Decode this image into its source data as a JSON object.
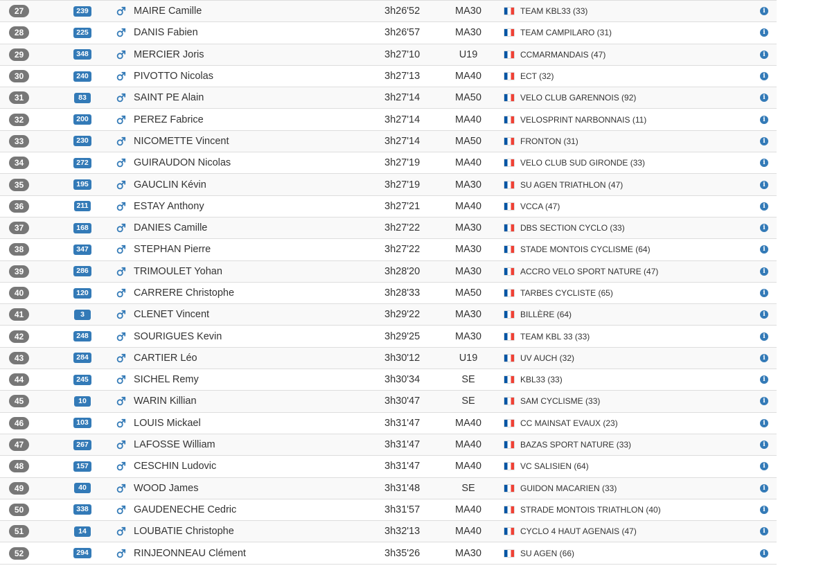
{
  "colors": {
    "rank_badge": "#777777",
    "bib_badge": "#337ab7",
    "male_icon": "#337ab7",
    "info_icon": "#337ab7",
    "row_alt": "#f9f9f9",
    "border": "#dddddd"
  },
  "icons": {
    "sex": "male-icon",
    "flag": "france-flag-icon",
    "info": "info-circle-icon"
  },
  "rows": [
    {
      "rank": "27",
      "bib": "239",
      "name": "MAIRE Camille",
      "time": "3h26'52",
      "category": "MA30",
      "club": "TEAM KBL33 (33)"
    },
    {
      "rank": "28",
      "bib": "225",
      "name": "DANIS Fabien",
      "time": "3h26'57",
      "category": "MA30",
      "club": "TEAM CAMPILARO (31)"
    },
    {
      "rank": "29",
      "bib": "348",
      "name": "MERCIER Joris",
      "time": "3h27'10",
      "category": "U19",
      "club": "CCMARMANDAIS (47)"
    },
    {
      "rank": "30",
      "bib": "240",
      "name": "PIVOTTO Nicolas",
      "time": "3h27'13",
      "category": "MA40",
      "club": "ECT (32)"
    },
    {
      "rank": "31",
      "bib": "83",
      "name": "SAINT PE Alain",
      "time": "3h27'14",
      "category": "MA50",
      "club": "VELO CLUB GARENNOIS (92)"
    },
    {
      "rank": "32",
      "bib": "200",
      "name": "PEREZ Fabrice",
      "time": "3h27'14",
      "category": "MA40",
      "club": "VELOSPRINT NARBONNAIS (11)"
    },
    {
      "rank": "33",
      "bib": "230",
      "name": "NICOMETTE Vincent",
      "time": "3h27'14",
      "category": "MA50",
      "club": "FRONTON (31)"
    },
    {
      "rank": "34",
      "bib": "272",
      "name": "GUIRAUDON Nicolas",
      "time": "3h27'19",
      "category": "MA40",
      "club": "VELO CLUB SUD GIRONDE (33)"
    },
    {
      "rank": "35",
      "bib": "195",
      "name": "GAUCLIN Kévin",
      "time": "3h27'19",
      "category": "MA30",
      "club": "SU AGEN TRIATHLON (47)"
    },
    {
      "rank": "36",
      "bib": "211",
      "name": "ESTAY Anthony",
      "time": "3h27'21",
      "category": "MA40",
      "club": "VCCA (47)"
    },
    {
      "rank": "37",
      "bib": "168",
      "name": "DANIES Camille",
      "time": "3h27'22",
      "category": "MA30",
      "club": "DBS SECTION CYCLO (33)"
    },
    {
      "rank": "38",
      "bib": "347",
      "name": "STEPHAN Pierre",
      "time": "3h27'22",
      "category": "MA30",
      "club": "STADE MONTOIS CYCLISME (64)"
    },
    {
      "rank": "39",
      "bib": "286",
      "name": "TRIMOULET Yohan",
      "time": "3h28'20",
      "category": "MA30",
      "club": "ACCRO VELO SPORT NATURE (47)"
    },
    {
      "rank": "40",
      "bib": "120",
      "name": "CARRERE Christophe",
      "time": "3h28'33",
      "category": "MA50",
      "club": "TARBES CYCLISTE (65)"
    },
    {
      "rank": "41",
      "bib": "3",
      "name": "CLENET Vincent",
      "time": "3h29'22",
      "category": "MA30",
      "club": "BILLÈRE (64)"
    },
    {
      "rank": "42",
      "bib": "248",
      "name": "SOURIGUES Kevin",
      "time": "3h29'25",
      "category": "MA30",
      "club": "TEAM KBL 33 (33)"
    },
    {
      "rank": "43",
      "bib": "284",
      "name": "CARTIER Léo",
      "time": "3h30'12",
      "category": "U19",
      "club": "UV AUCH (32)"
    },
    {
      "rank": "44",
      "bib": "245",
      "name": "SICHEL Remy",
      "time": "3h30'34",
      "category": "SE",
      "club": "KBL33 (33)"
    },
    {
      "rank": "45",
      "bib": "10",
      "name": "WARIN Killian",
      "time": "3h30'47",
      "category": "SE",
      "club": "SAM CYCLISME (33)"
    },
    {
      "rank": "46",
      "bib": "103",
      "name": "LOUIS Mickael",
      "time": "3h31'47",
      "category": "MA40",
      "club": "CC MAINSAT EVAUX (23)"
    },
    {
      "rank": "47",
      "bib": "267",
      "name": "LAFOSSE William",
      "time": "3h31'47",
      "category": "MA40",
      "club": "BAZAS SPORT NATURE (33)"
    },
    {
      "rank": "48",
      "bib": "157",
      "name": "CESCHIN Ludovic",
      "time": "3h31'47",
      "category": "MA40",
      "club": "VC SALISIEN (64)"
    },
    {
      "rank": "49",
      "bib": "40",
      "name": "WOOD James",
      "time": "3h31'48",
      "category": "SE",
      "club": "GUIDON MACARIEN (33)"
    },
    {
      "rank": "50",
      "bib": "338",
      "name": "GAUDENECHE Cedric",
      "time": "3h31'57",
      "category": "MA40",
      "club": "STRADE MONTOIS TRIATHLON (40)"
    },
    {
      "rank": "51",
      "bib": "14",
      "name": "LOUBATIE Christophe",
      "time": "3h32'13",
      "category": "MA40",
      "club": "CYCLO 4 HAUT AGENAIS (47)"
    },
    {
      "rank": "52",
      "bib": "294",
      "name": "RINJEONNEAU Clément",
      "time": "3h35'26",
      "category": "MA30",
      "club": "SU AGEN (66)"
    }
  ]
}
